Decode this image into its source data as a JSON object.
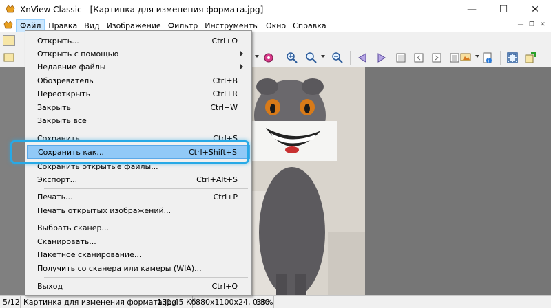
{
  "window": {
    "title": "XnView Classic - [Картинка для изменения формата.jpg]",
    "minimize": "—",
    "maximize": "☐",
    "close": "✕"
  },
  "menubar": {
    "items": [
      "Файл",
      "Правка",
      "Вид",
      "Изображение",
      "Фильтр",
      "Инструменты",
      "Окно",
      "Справка"
    ],
    "active": "Файл"
  },
  "file_menu": {
    "items": [
      {
        "label": "Открыть...",
        "shortcut": "Ctrl+O"
      },
      {
        "label": "Открыть с помощью",
        "shortcut": "",
        "submenu": true
      },
      {
        "label": "Недавние файлы",
        "shortcut": "",
        "submenu": true
      },
      {
        "label": "Обозреватель",
        "shortcut": "Ctrl+B"
      },
      {
        "label": "Переоткрыть",
        "shortcut": "Ctrl+R"
      },
      {
        "label": "Закрыть",
        "shortcut": "Ctrl+W"
      },
      {
        "label": "Закрыть все",
        "shortcut": ""
      },
      {
        "label": "Сохранить",
        "shortcut": "Ctrl+S"
      },
      {
        "label": "Сохранить как...",
        "shortcut": "Ctrl+Shift+S",
        "highlighted": true
      },
      {
        "label": "Сохранить открытые файлы...",
        "shortcut": ""
      },
      {
        "label": "Экспорт...",
        "shortcut": "Ctrl+Alt+S"
      },
      {
        "label": "Печать...",
        "shortcut": "Ctrl+P"
      },
      {
        "label": "Печать открытых изображений...",
        "shortcut": ""
      },
      {
        "label": "Выбрать сканер...",
        "shortcut": ""
      },
      {
        "label": "Сканировать...",
        "shortcut": ""
      },
      {
        "label": "Пакетное сканирование...",
        "shortcut": ""
      },
      {
        "label": "Получить со сканера или камеры (WIA)...",
        "shortcut": ""
      },
      {
        "label": "Выход",
        "shortcut": "Ctrl+Q"
      }
    ]
  },
  "statusbar": {
    "index": "5/12",
    "filename": "Картинка для изменения формата.jpg",
    "filesize": "131.45 Кб",
    "dims": "880x1100x24, 0.80",
    "zoom": "33%"
  },
  "colors": {
    "highlight": "#91c9f7",
    "focus_ring": "#27a9e6",
    "workspace": "#767676"
  }
}
